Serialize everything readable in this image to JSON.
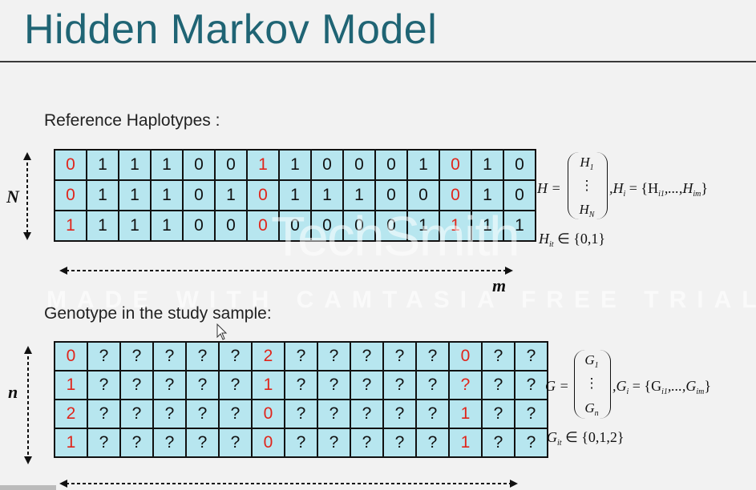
{
  "slide": {
    "title": "Hidden Markov Model",
    "reference_label": "Reference Haplotypes :",
    "genotype_label": "Genotype in the study sample:",
    "N_label": "N",
    "n_label": "n",
    "m_label": "m"
  },
  "reference_grid": [
    [
      {
        "v": "0",
        "red": true
      },
      {
        "v": "1"
      },
      {
        "v": "1"
      },
      {
        "v": "1"
      },
      {
        "v": "0"
      },
      {
        "v": "0"
      },
      {
        "v": "1",
        "red": true
      },
      {
        "v": "1"
      },
      {
        "v": "0"
      },
      {
        "v": "0"
      },
      {
        "v": "0"
      },
      {
        "v": "1"
      },
      {
        "v": "0",
        "red": true
      },
      {
        "v": "1"
      },
      {
        "v": "0"
      }
    ],
    [
      {
        "v": "0",
        "red": true
      },
      {
        "v": "1"
      },
      {
        "v": "1"
      },
      {
        "v": "1"
      },
      {
        "v": "0"
      },
      {
        "v": "1"
      },
      {
        "v": "0",
        "red": true
      },
      {
        "v": "1"
      },
      {
        "v": "1"
      },
      {
        "v": "1"
      },
      {
        "v": "0"
      },
      {
        "v": "0"
      },
      {
        "v": "0",
        "red": true
      },
      {
        "v": "1"
      },
      {
        "v": "0"
      }
    ],
    [
      {
        "v": "1",
        "red": true
      },
      {
        "v": "1"
      },
      {
        "v": "1"
      },
      {
        "v": "1"
      },
      {
        "v": "0"
      },
      {
        "v": "0"
      },
      {
        "v": "0",
        "red": true
      },
      {
        "v": "0"
      },
      {
        "v": "0"
      },
      {
        "v": "0"
      },
      {
        "v": "0"
      },
      {
        "v": "1"
      },
      {
        "v": "1",
        "red": true
      },
      {
        "v": "1"
      },
      {
        "v": "1"
      }
    ]
  ],
  "genotype_grid": [
    [
      {
        "v": "0",
        "red": true
      },
      {
        "v": "?"
      },
      {
        "v": "?"
      },
      {
        "v": "?"
      },
      {
        "v": "?"
      },
      {
        "v": "?"
      },
      {
        "v": "2",
        "red": true
      },
      {
        "v": "?"
      },
      {
        "v": "?"
      },
      {
        "v": "?"
      },
      {
        "v": "?"
      },
      {
        "v": "?"
      },
      {
        "v": "0",
        "red": true
      },
      {
        "v": "?"
      },
      {
        "v": "?"
      }
    ],
    [
      {
        "v": "1",
        "red": true
      },
      {
        "v": "?"
      },
      {
        "v": "?"
      },
      {
        "v": "?"
      },
      {
        "v": "?"
      },
      {
        "v": "?"
      },
      {
        "v": "1",
        "red": true
      },
      {
        "v": "?"
      },
      {
        "v": "?"
      },
      {
        "v": "?"
      },
      {
        "v": "?"
      },
      {
        "v": "?"
      },
      {
        "v": "?",
        "red": true
      },
      {
        "v": "?"
      },
      {
        "v": "?"
      }
    ],
    [
      {
        "v": "2",
        "red": true
      },
      {
        "v": "?"
      },
      {
        "v": "?"
      },
      {
        "v": "?"
      },
      {
        "v": "?"
      },
      {
        "v": "?"
      },
      {
        "v": "0",
        "red": true
      },
      {
        "v": "?"
      },
      {
        "v": "?"
      },
      {
        "v": "?"
      },
      {
        "v": "?"
      },
      {
        "v": "?"
      },
      {
        "v": "1",
        "red": true
      },
      {
        "v": "?"
      },
      {
        "v": "?"
      }
    ],
    [
      {
        "v": "1",
        "red": true
      },
      {
        "v": "?"
      },
      {
        "v": "?"
      },
      {
        "v": "?"
      },
      {
        "v": "?"
      },
      {
        "v": "?"
      },
      {
        "v": "0",
        "red": true
      },
      {
        "v": "?"
      },
      {
        "v": "?"
      },
      {
        "v": "?"
      },
      {
        "v": "?"
      },
      {
        "v": "?"
      },
      {
        "v": "1",
        "red": true
      },
      {
        "v": "?"
      },
      {
        "v": "?"
      }
    ]
  ],
  "formulas": {
    "H_lhs": "H =",
    "H_col": [
      "H",
      "⋮",
      "H"
    ],
    "H_col_subs": [
      "1",
      "",
      "N"
    ],
    "H_rhs": ",H",
    "H_rhs_sub": "i",
    "H_set": "= {H",
    "H_set_sub1": "i1",
    "H_set_mid": ",...,H",
    "H_set_sub2": "im",
    "H_set_end": "}",
    "H_dom": "H",
    "H_dom_sub": "it",
    "H_dom_set": "∈ {0,1}",
    "G_lhs": "G =",
    "G_col": [
      "G",
      "⋮",
      "G"
    ],
    "G_col_subs": [
      "1",
      "",
      "n"
    ],
    "G_rhs": ",G",
    "G_rhs_sub": "i",
    "G_set": "= {G",
    "G_set_sub1": "i1",
    "G_set_mid": ",...,G",
    "G_set_sub2": "im",
    "G_set_end": "}",
    "G_dom": "G",
    "G_dom_sub": "it",
    "G_dom_set": "∈ {0,1,2}"
  },
  "watermark": {
    "brand": "TechSmith",
    "tagline": "MADE WITH CAMTASIA FREE TRIAL"
  },
  "colors": {
    "title": "#1f6474",
    "cell_fill": "#b7e6ef",
    "highlight": "#e0251b"
  }
}
